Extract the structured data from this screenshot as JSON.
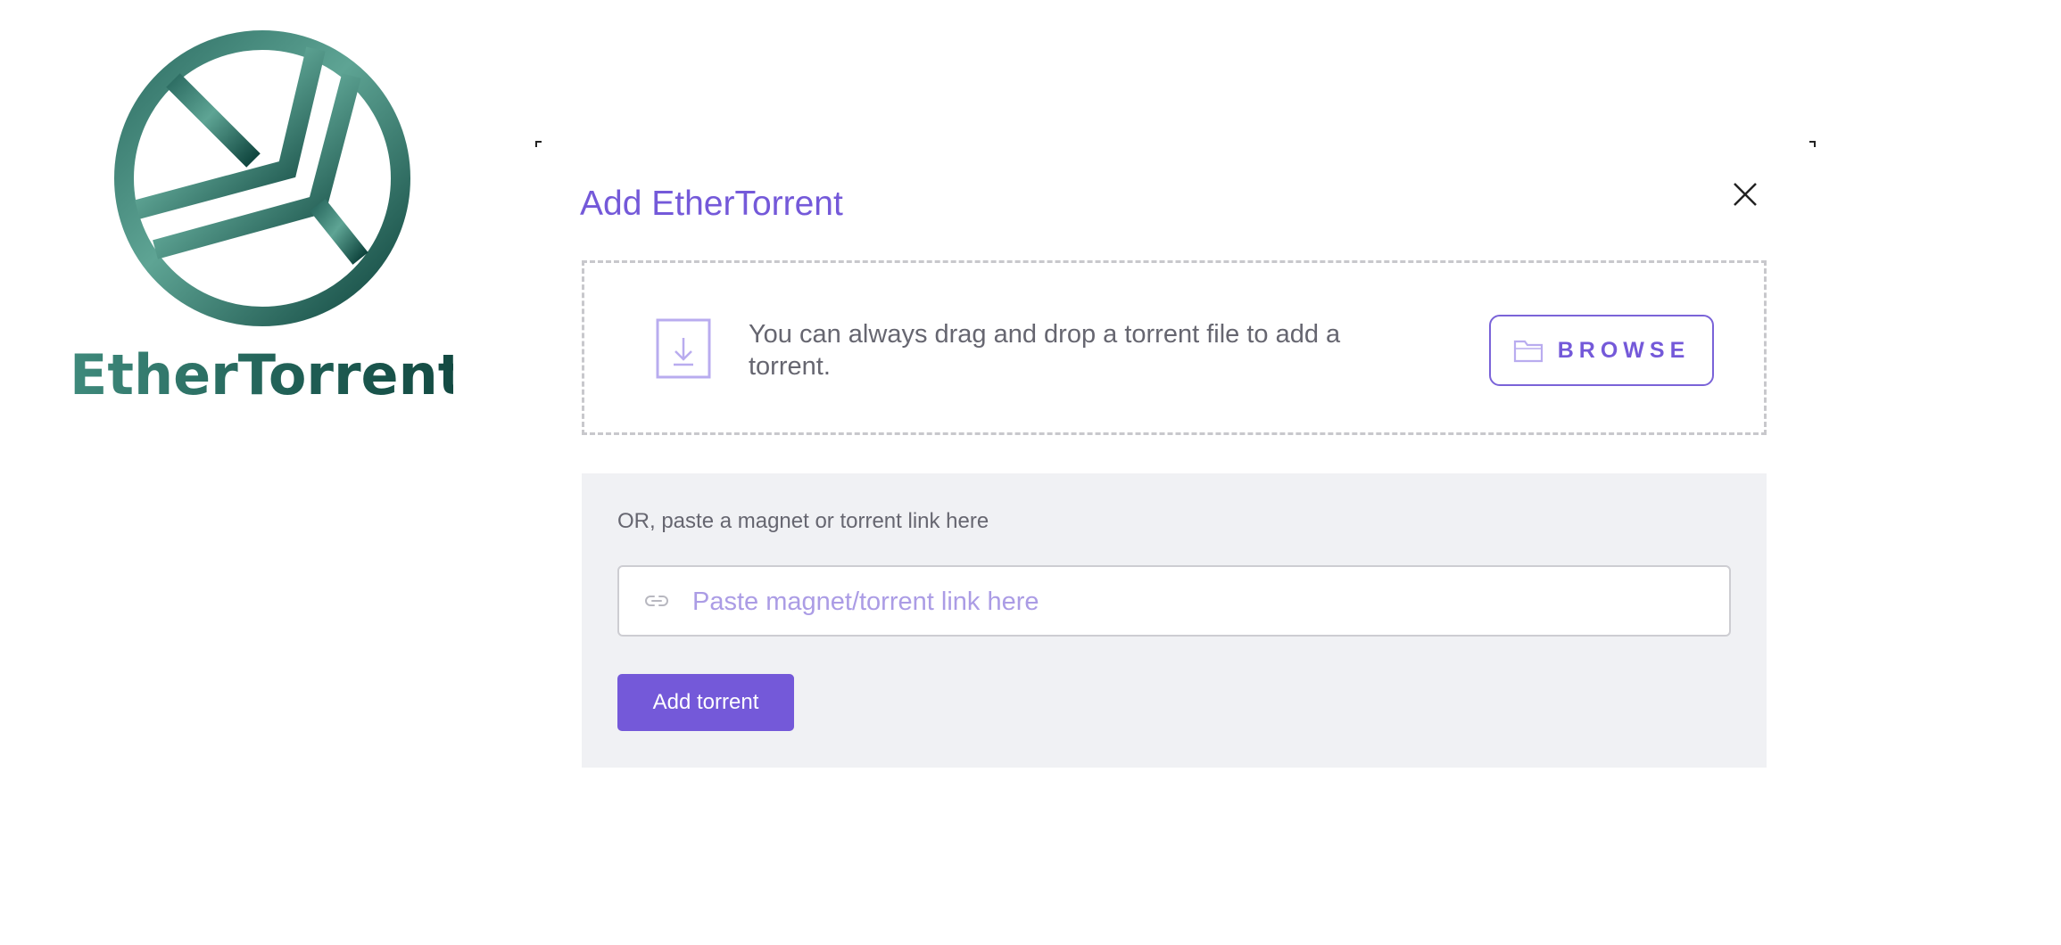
{
  "app": {
    "brand_name": "EtherTorrent",
    "logo_icon": "ethertorrent-logo-icon"
  },
  "modal": {
    "title": "Add EtherTorrent",
    "close_icon": "close-icon",
    "dropzone": {
      "icon": "download-file-icon",
      "text": "You can always drag and drop a torrent file to add a torrent.",
      "browse_label": "BROWSE",
      "browse_icon": "folder-icon"
    },
    "link_section": {
      "label": "OR, paste a magnet or torrent link here",
      "input_value": "",
      "input_placeholder": "Paste magnet/torrent link here",
      "input_icon": "link-icon",
      "submit_label": "Add torrent"
    }
  },
  "colors": {
    "accent": "#7459d9",
    "accent_light": "#ab9ce5",
    "brand_green": "#1f5e54",
    "panel_bg": "#f0f1f4",
    "text_muted": "#666670"
  }
}
